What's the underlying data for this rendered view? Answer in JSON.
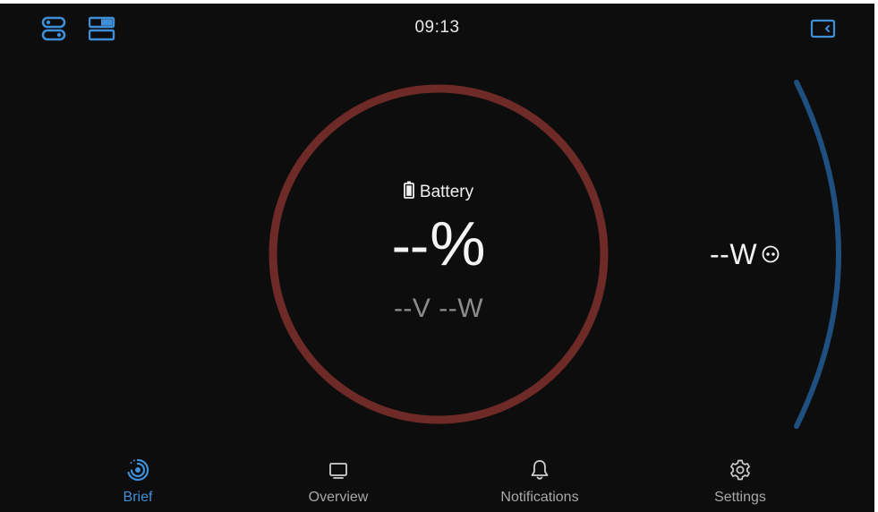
{
  "statusbar": {
    "time": "09:13",
    "left_icons": [
      "toggle-switches-icon",
      "split-panel-icon"
    ],
    "right_icon": "collapse-panel-icon"
  },
  "battery": {
    "label": "Battery",
    "icon": "battery-icon",
    "percent_value": "--",
    "percent_unit": "%",
    "voltage_power": "--V --W",
    "ring_color": "#6e2a26"
  },
  "load": {
    "value": "--W",
    "icon": "ac-outlet-icon",
    "arc_color": "#1e4f7e"
  },
  "nav": {
    "items": [
      {
        "label": "Brief",
        "icon": "brief-gauge-icon",
        "active": true
      },
      {
        "label": "Overview",
        "icon": "overview-screen-icon",
        "active": false
      },
      {
        "label": "Notifications",
        "icon": "bell-icon",
        "active": false
      },
      {
        "label": "Settings",
        "icon": "gear-icon",
        "active": false
      }
    ]
  },
  "colors": {
    "background": "#0d0d0d",
    "accent": "#3f8fd8",
    "text": "#f0f0f0",
    "muted_text": "#8c8c8c"
  }
}
